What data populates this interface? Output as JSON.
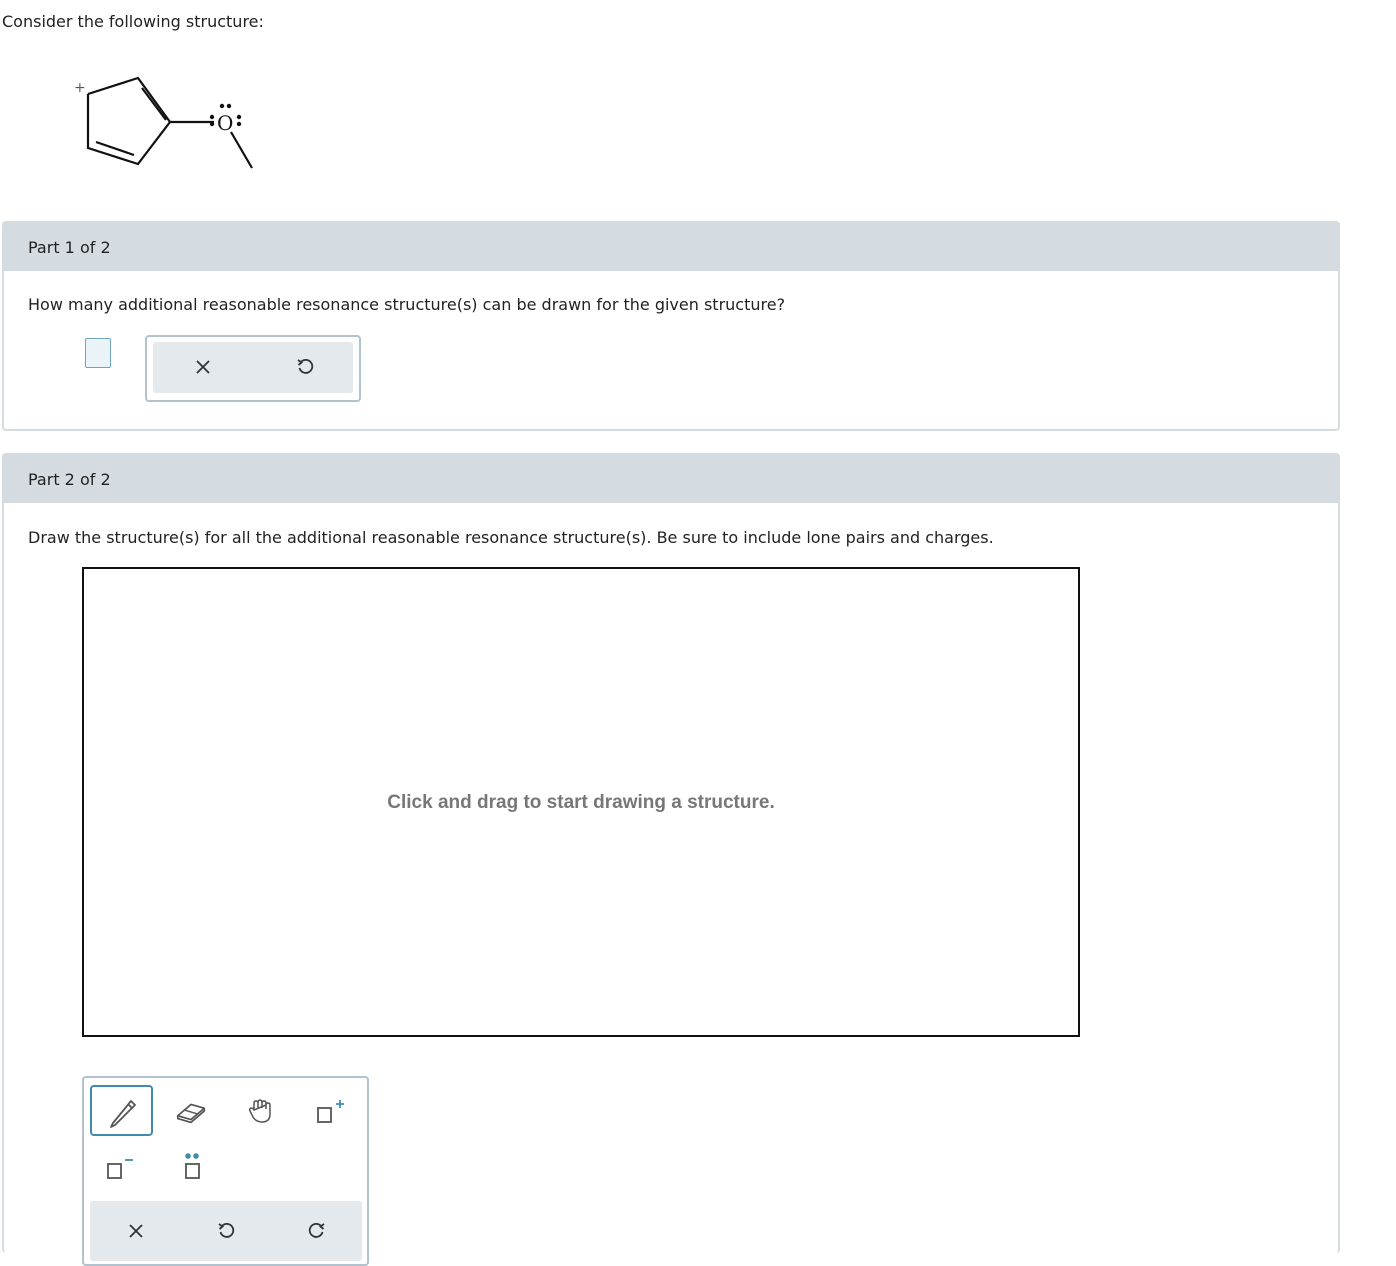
{
  "intro": "Consider the following structure:",
  "molecule": {
    "charge": "+",
    "oxygen": "O"
  },
  "part1": {
    "header": "Part 1 of 2",
    "question": "How many additional reasonable resonance structure(s) can be drawn for the given structure?",
    "answer_value": "",
    "buttons": {
      "clear": "clear-icon",
      "undo": "undo-icon"
    }
  },
  "part2": {
    "header": "Part 2 of 2",
    "question": "Draw the structure(s) for all the additional reasonable resonance structure(s). Be sure to include lone pairs and charges.",
    "canvas_hint": "Click and drag to start drawing a structure.",
    "tools": [
      "pencil-icon",
      "eraser-icon",
      "hand-icon",
      "add-positive-charge-icon",
      "add-negative-charge-icon",
      "add-lone-pair-icon"
    ],
    "actions": [
      "clear-icon",
      "undo-icon",
      "redo-icon"
    ]
  },
  "colors": {
    "header_bg": "#d5dce1",
    "accent": "#3f8bb0",
    "toolbar_border": "#b3c2cc"
  }
}
